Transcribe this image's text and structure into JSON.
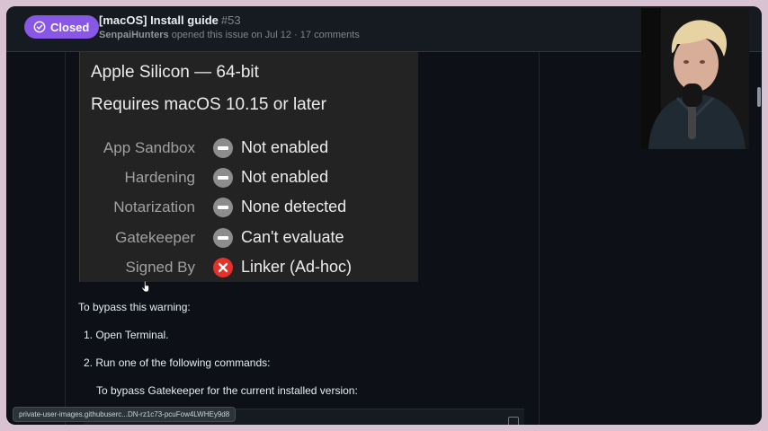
{
  "issue": {
    "status": "Closed",
    "title": "[macOS] Install guide",
    "number": "#53",
    "author": "SenpaiHunters",
    "meta_rest": " opened this issue on Jul 12 · 17 comments"
  },
  "security_panel": {
    "architecture": "Apple Silicon — 64-bit",
    "requirement": "Requires macOS 10.15 or later",
    "rows": [
      {
        "label": "App Sandbox",
        "icon": "minus-circle-icon",
        "value": "Not enabled"
      },
      {
        "label": "Hardening",
        "icon": "minus-circle-icon",
        "value": "Not enabled"
      },
      {
        "label": "Notarization",
        "icon": "minus-circle-icon",
        "value": "None detected"
      },
      {
        "label": "Gatekeeper",
        "icon": "minus-circle-icon",
        "value": "Can't evaluate"
      },
      {
        "label": "Signed By",
        "icon": "x-circle-icon",
        "value": "Linker (Ad-hoc)"
      }
    ]
  },
  "instructions": {
    "intro": "To bypass this warning:",
    "step1": "1. Open Terminal.",
    "step2": "2. Run one of the following commands:",
    "step2_sub": "To bypass Gatekeeper for the current installed version:"
  },
  "status_bar": {
    "link_preview": "private-user-images.githubuserc...DN-rz1c73-pcuFow4LWHEy9d8"
  },
  "colors": {
    "closed_purple": "#8957e5",
    "error_red": "#e5302b",
    "page_bg": "#0d1117"
  }
}
